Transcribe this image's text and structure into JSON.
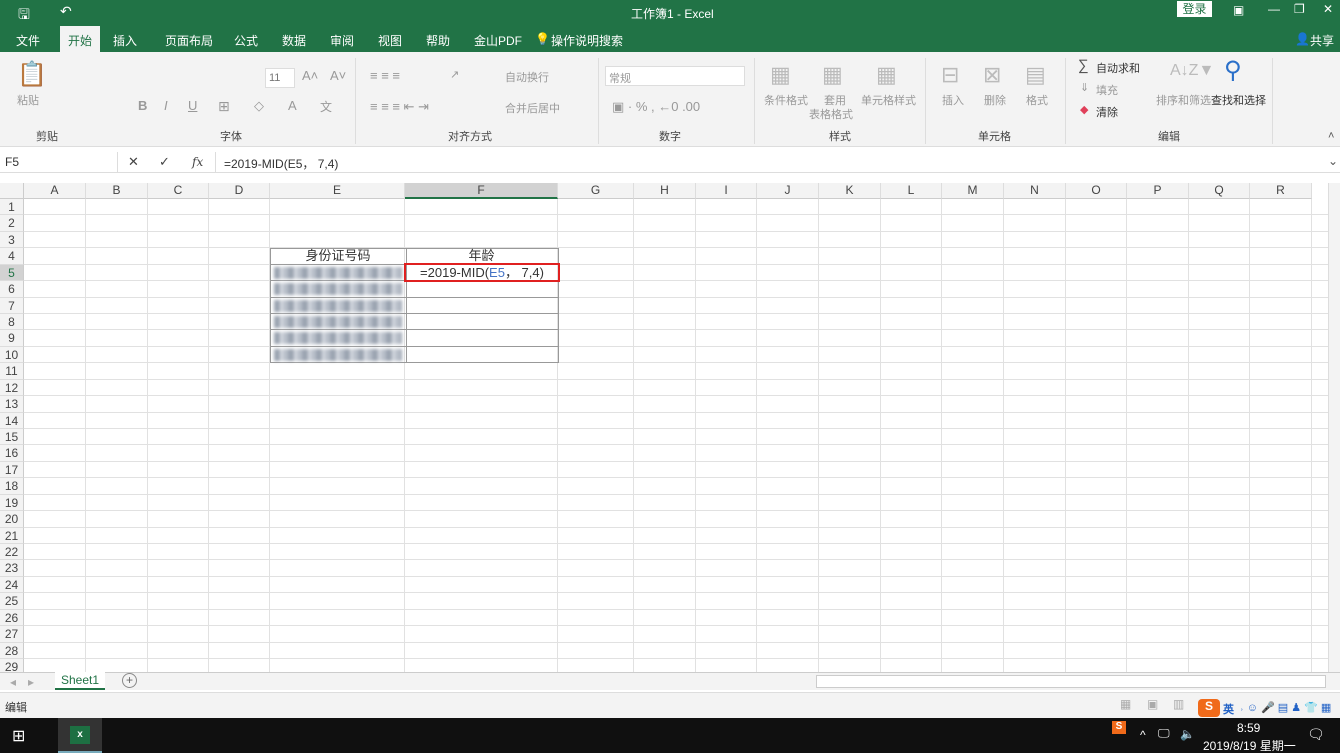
{
  "title": {
    "text": "工作簿1  -  Excel",
    "login": "登录",
    "share": "共享"
  },
  "tabs": [
    "文件",
    "开始",
    "插入",
    "页面布局",
    "公式",
    "数据",
    "审阅",
    "视图",
    "帮助",
    "金山PDF",
    "操作说明搜索"
  ],
  "ribbon": {
    "paste": "粘贴",
    "clipboard_group": "剪贴",
    "font_size": "11",
    "font_group": "字体",
    "wrap": "自动换行",
    "merge": "合并后居中",
    "align_group": "对齐方式",
    "number_format": "常规",
    "number_group": "数字",
    "cond": "条件格式",
    "table1": "套用",
    "table2": "表格格式",
    "cellstyle": "单元格样式",
    "style_group": "样式",
    "insert": "插入",
    "delete": "删除",
    "format": "格式",
    "cells_group": "单元格",
    "autosum": "自动求和",
    "fill": "填充",
    "clear": "清除",
    "sort": "排序和筛选",
    "find": "查找和选择",
    "edit_group": "编辑"
  },
  "formula_bar": {
    "name_box": "F5",
    "formula": "=2019-MID(E5，  7,4)",
    "fx": "fx"
  },
  "columns": [
    "A",
    "B",
    "C",
    "D",
    "E",
    "F",
    "G",
    "H",
    "I",
    "J",
    "K",
    "L",
    "M",
    "N",
    "O",
    "P",
    "Q",
    "R"
  ],
  "cells": {
    "E4": "身份证号码",
    "F4": "年龄",
    "F5_prefix": "=2019-MID(",
    "F5_ref": "E5",
    "F5_suffix": "，  7,4)"
  },
  "sheet_tab": "Sheet1",
  "status": "编辑",
  "taskbar": {
    "time": "8:59",
    "date": "2019/8/19 星期一",
    "ime": "英"
  },
  "colors": {
    "accent": "#217346",
    "highlight_border": "#e02020",
    "ref_blue": "#4472c4"
  }
}
